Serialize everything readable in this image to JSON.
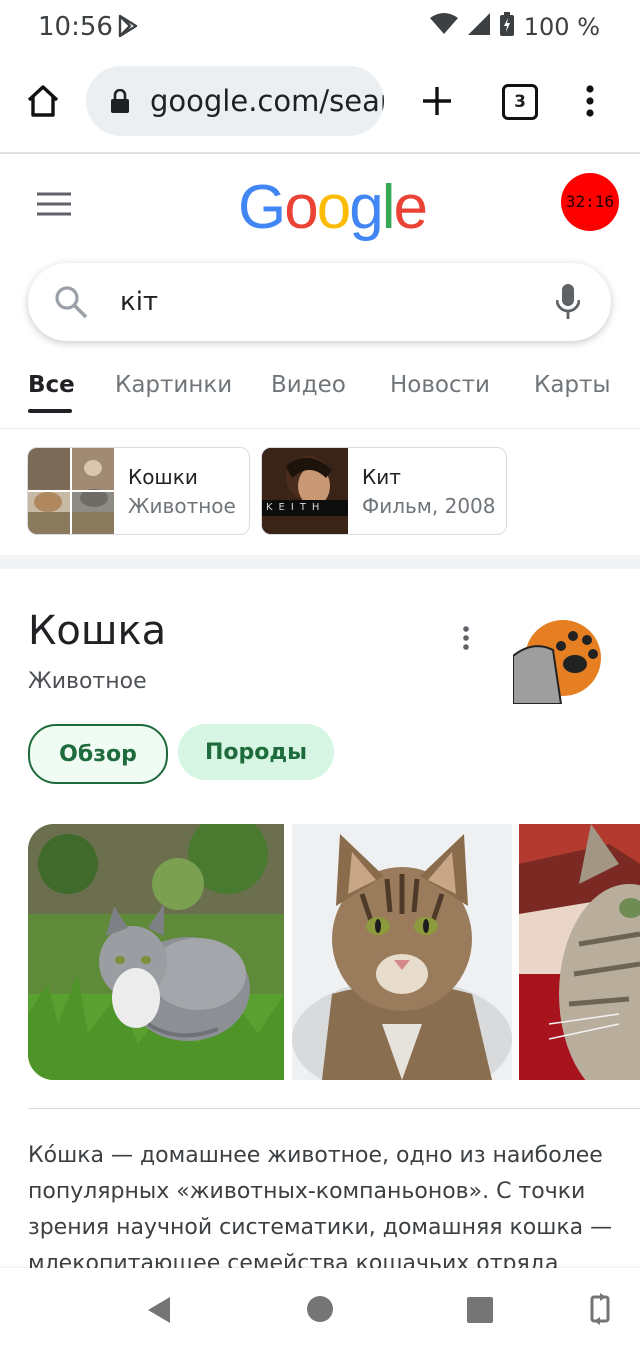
{
  "status_bar": {
    "time": "10:56",
    "battery": "100 %"
  },
  "browser": {
    "url": "google.com/search",
    "tab_count": "3"
  },
  "google": {
    "logo_letters": [
      "G",
      "o",
      "o",
      "g",
      "l",
      "e"
    ],
    "logo_colors": [
      "#4285F4",
      "#EA4335",
      "#FBBC05",
      "#4285F4",
      "#34A853",
      "#EA4335"
    ],
    "avatar_text": "32:16",
    "search_query": "кіт"
  },
  "tabs": [
    "Все",
    "Картинки",
    "Видео",
    "Новости",
    "Карты"
  ],
  "chips": [
    {
      "title": "Кошки",
      "subtitle": "Животное"
    },
    {
      "title": "Кит",
      "subtitle": "Фильм, 2008",
      "thumb_text": "KEITH"
    }
  ],
  "knowledge_panel": {
    "title": "Кошка",
    "subtitle": "Животное",
    "buttons": [
      "Обзор",
      "Породы"
    ],
    "description": "Ко́шка — домашнее животное, одно из наиболее популярных «животных-компаньонов». С точки зрения научной систематики, домашняя кошка — млекопитающее семейства кошачьих отряда хищных."
  },
  "colors": {
    "accent_green": "#1e6b3c",
    "avatar_red": "#ff0000"
  }
}
